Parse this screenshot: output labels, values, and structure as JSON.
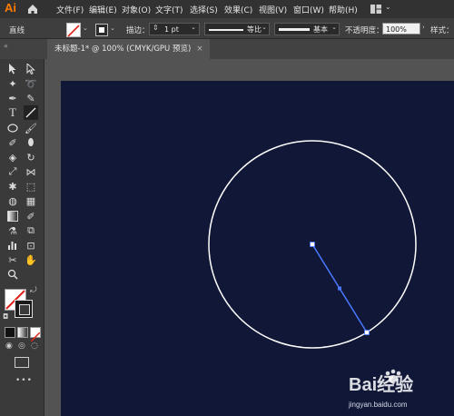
{
  "app": {
    "logo": "Ai"
  },
  "menu": {
    "items": [
      "文件(F)",
      "编辑(E)",
      "对象(O)",
      "文字(T)",
      "选择(S)",
      "效果(C)",
      "视图(V)",
      "窗口(W)",
      "帮助(H)"
    ]
  },
  "control_bar": {
    "selection_label": "直线",
    "stroke_label": "描边：",
    "stroke_weight": "1 pt",
    "profile_label": "等比",
    "brush_label": "基本",
    "opacity_label": "不透明度：",
    "opacity_value": "100%",
    "style_label": "样式："
  },
  "document": {
    "tab_title": "未标题-1* @ 100% (CMYK/GPU 预览)",
    "close_glyph": "×"
  },
  "canvas": {
    "artboard_color": "#101737",
    "circle_stroke": "#ffffff",
    "line_color": "#4a78ff"
  },
  "toolbar": {
    "more_label": "•••"
  },
  "watermark": {
    "brand": "Bai经验",
    "url": "jingyan.baidu.com"
  },
  "icons": {
    "home": "home-icon",
    "workspace": "workspace-icon",
    "paw": "paw-icon"
  }
}
